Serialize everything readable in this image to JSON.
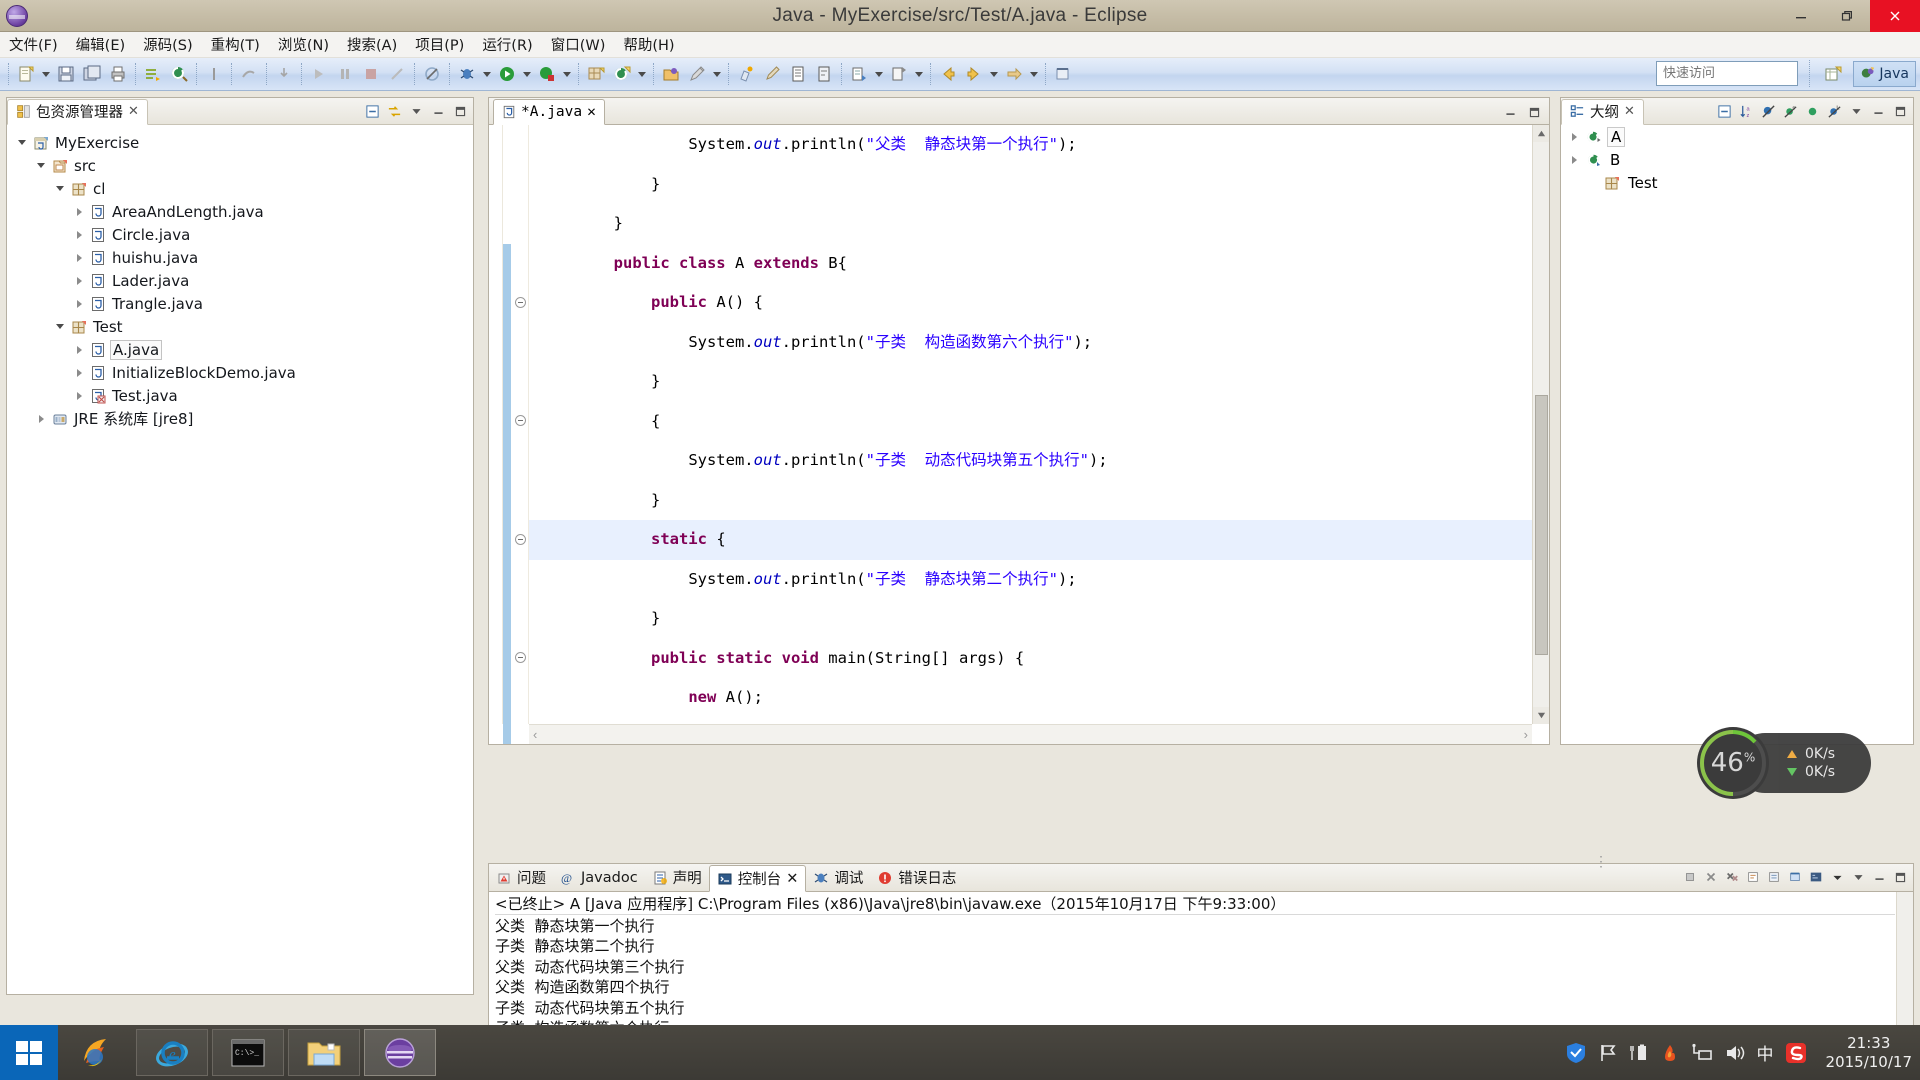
{
  "window": {
    "title": "Java - MyExercise/src/Test/A.java - Eclipse",
    "app_icon": "eclipse-icon",
    "minimize_label": "Minimize",
    "restore_label": "Restore",
    "close_label": "Close"
  },
  "menubar": {
    "items": [
      {
        "label": "文件(F)",
        "name": "menu-file"
      },
      {
        "label": "编辑(E)",
        "name": "menu-edit"
      },
      {
        "label": "源码(S)",
        "name": "menu-source"
      },
      {
        "label": "重构(T)",
        "name": "menu-refactor"
      },
      {
        "label": "浏览(N)",
        "name": "menu-navigate"
      },
      {
        "label": "搜索(A)",
        "name": "menu-search"
      },
      {
        "label": "项目(P)",
        "name": "menu-project"
      },
      {
        "label": "运行(R)",
        "name": "menu-run"
      },
      {
        "label": "窗口(W)",
        "name": "menu-window"
      },
      {
        "label": "帮助(H)",
        "name": "menu-help"
      }
    ]
  },
  "toolbar": {
    "quick_access_placeholder": "快速访问",
    "perspective_label": "Java",
    "open_perspective_tooltip": "打开透视图"
  },
  "package_explorer": {
    "title": "包资源管理器",
    "tree": [
      {
        "label": "MyExercise",
        "indent": 0,
        "twist": "expanded",
        "icon": "java-project-icon",
        "selected": false
      },
      {
        "label": "src",
        "indent": 1,
        "twist": "expanded",
        "icon": "source-folder-icon",
        "selected": false
      },
      {
        "label": "cl",
        "indent": 2,
        "twist": "expanded",
        "icon": "package-icon",
        "selected": false
      },
      {
        "label": "AreaAndLength.java",
        "indent": 3,
        "twist": "collapsed",
        "icon": "java-file-icon",
        "selected": false
      },
      {
        "label": "Circle.java",
        "indent": 3,
        "twist": "collapsed",
        "icon": "java-file-icon",
        "selected": false
      },
      {
        "label": "huishu.java",
        "indent": 3,
        "twist": "collapsed",
        "icon": "java-file-icon",
        "selected": false
      },
      {
        "label": "Lader.java",
        "indent": 3,
        "twist": "collapsed",
        "icon": "java-file-icon",
        "selected": false
      },
      {
        "label": "Trangle.java",
        "indent": 3,
        "twist": "collapsed",
        "icon": "java-file-icon",
        "selected": false
      },
      {
        "label": "Test",
        "indent": 2,
        "twist": "expanded",
        "icon": "package-icon",
        "selected": false
      },
      {
        "label": "A.java",
        "indent": 3,
        "twist": "collapsed",
        "icon": "java-file-icon",
        "selected": true
      },
      {
        "label": "InitializeBlockDemo.java",
        "indent": 3,
        "twist": "collapsed",
        "icon": "java-file-icon",
        "selected": false
      },
      {
        "label": "Test.java",
        "indent": 3,
        "twist": "collapsed",
        "icon": "java-main-file-icon",
        "selected": false
      },
      {
        "label": "JRE 系统库 [jre8]",
        "indent": 1,
        "twist": "collapsed",
        "icon": "jre-library-icon",
        "selected": false
      }
    ]
  },
  "editor": {
    "tab_label": "*A.java",
    "tab_icon": "java-file-icon",
    "lines": [
      {
        "indent": 4,
        "fold": false,
        "changed": false,
        "highlight": false,
        "tokens": [
          {
            "t": "pln",
            "v": "System."
          },
          {
            "t": "fld",
            "v": "out"
          },
          {
            "t": "pln",
            "v": ".println("
          },
          {
            "t": "str",
            "v": "\"父类  静态块第一个执行\""
          },
          {
            "t": "pln",
            "v": ");"
          }
        ]
      },
      {
        "indent": 3,
        "fold": false,
        "changed": false,
        "highlight": false,
        "tokens": [
          {
            "t": "pln",
            "v": "}"
          }
        ]
      },
      {
        "indent": 2,
        "fold": false,
        "changed": false,
        "highlight": false,
        "tokens": [
          {
            "t": "pln",
            "v": "}"
          }
        ]
      },
      {
        "indent": 2,
        "fold": false,
        "changed": true,
        "highlight": false,
        "tokens": [
          {
            "t": "kw",
            "v": "public class"
          },
          {
            "t": "pln",
            "v": " A "
          },
          {
            "t": "kw",
            "v": "extends"
          },
          {
            "t": "pln",
            "v": " B{"
          }
        ]
      },
      {
        "indent": 3,
        "fold": true,
        "changed": true,
        "highlight": false,
        "tokens": [
          {
            "t": "kw",
            "v": "public"
          },
          {
            "t": "pln",
            "v": " A() {"
          }
        ]
      },
      {
        "indent": 4,
        "fold": false,
        "changed": true,
        "highlight": false,
        "tokens": [
          {
            "t": "pln",
            "v": "System."
          },
          {
            "t": "fld",
            "v": "out"
          },
          {
            "t": "pln",
            "v": ".println("
          },
          {
            "t": "str",
            "v": "\"子类  构造函数第六个执行\""
          },
          {
            "t": "pln",
            "v": ");"
          }
        ]
      },
      {
        "indent": 3,
        "fold": false,
        "changed": true,
        "highlight": false,
        "tokens": [
          {
            "t": "pln",
            "v": "}"
          }
        ]
      },
      {
        "indent": 3,
        "fold": true,
        "changed": true,
        "highlight": false,
        "tokens": [
          {
            "t": "pln",
            "v": "{"
          }
        ]
      },
      {
        "indent": 4,
        "fold": false,
        "changed": true,
        "highlight": false,
        "tokens": [
          {
            "t": "pln",
            "v": "System."
          },
          {
            "t": "fld",
            "v": "out"
          },
          {
            "t": "pln",
            "v": ".println("
          },
          {
            "t": "str",
            "v": "\"子类  动态代码块第五个执行\""
          },
          {
            "t": "pln",
            "v": ");"
          }
        ]
      },
      {
        "indent": 3,
        "fold": false,
        "changed": true,
        "highlight": false,
        "tokens": [
          {
            "t": "pln",
            "v": "}"
          }
        ]
      },
      {
        "indent": 3,
        "fold": true,
        "changed": true,
        "highlight": true,
        "tokens": [
          {
            "t": "kw",
            "v": "static"
          },
          {
            "t": "pln",
            "v": " {"
          }
        ]
      },
      {
        "indent": 4,
        "fold": false,
        "changed": true,
        "highlight": false,
        "tokens": [
          {
            "t": "pln",
            "v": "System."
          },
          {
            "t": "fld",
            "v": "out"
          },
          {
            "t": "pln",
            "v": ".println("
          },
          {
            "t": "str",
            "v": "\"子类  静态块第二个执行\""
          },
          {
            "t": "pln",
            "v": ");"
          }
        ]
      },
      {
        "indent": 3,
        "fold": false,
        "changed": true,
        "highlight": false,
        "tokens": [
          {
            "t": "pln",
            "v": "}"
          }
        ]
      },
      {
        "indent": 3,
        "fold": true,
        "changed": true,
        "highlight": false,
        "tokens": [
          {
            "t": "kw",
            "v": "public static void"
          },
          {
            "t": "pln",
            "v": " main(String[] args) {"
          }
        ]
      },
      {
        "indent": 4,
        "fold": false,
        "changed": true,
        "highlight": false,
        "tokens": [
          {
            "t": "kw",
            "v": "new"
          },
          {
            "t": "pln",
            "v": " A();"
          }
        ]
      },
      {
        "indent": 3,
        "fold": false,
        "changed": true,
        "highlight": false,
        "tokens": [
          {
            "t": "pln",
            "v": "}"
          }
        ]
      }
    ]
  },
  "outline": {
    "title": "大纲",
    "items": [
      {
        "label": "Test",
        "indent": 1,
        "twist": "none",
        "icon": "package-icon",
        "selected": false
      },
      {
        "label": "B",
        "indent": 0,
        "twist": "collapsed",
        "icon": "class-icon",
        "selected": false
      },
      {
        "label": "A",
        "indent": 0,
        "twist": "collapsed",
        "icon": "class-default-icon",
        "selected": true
      }
    ],
    "tools": [
      {
        "name": "collapse-all-icon"
      },
      {
        "name": "sort-alphabetical-icon"
      },
      {
        "name": "hide-fields-icon"
      },
      {
        "name": "hide-static-icon"
      },
      {
        "name": "hide-public-icon"
      },
      {
        "name": "hide-local-types-icon"
      },
      {
        "name": "view-menu-icon"
      },
      {
        "name": "minimize-icon"
      },
      {
        "name": "maximize-icon"
      }
    ]
  },
  "console": {
    "tabs": [
      {
        "label": "问题",
        "icon": "problems-icon",
        "active": false,
        "closable": false
      },
      {
        "label": "Javadoc",
        "icon": "javadoc-icon",
        "active": false,
        "closable": false
      },
      {
        "label": "声明",
        "icon": "declaration-icon",
        "active": false,
        "closable": false
      },
      {
        "label": "控制台",
        "icon": "console-icon",
        "active": true,
        "closable": true
      },
      {
        "label": "调试",
        "icon": "debug-icon",
        "active": false,
        "closable": false
      },
      {
        "label": "错误日志",
        "icon": "error-log-icon",
        "active": false,
        "closable": false
      }
    ],
    "header": "<已终止> A [Java 应用程序] C:\\Program Files (x86)\\Java\\jre8\\bin\\javaw.exe（2015年10月17日 下午9:33:00）",
    "output": [
      "父类  静态块第一个执行",
      "子类  静态块第二个执行",
      "父类  动态代码块第三个执行",
      "父类  构造函数第四个执行",
      "子类  动态代码块第五个执行",
      "子类  构造函数第六个执行"
    ]
  },
  "netspeed": {
    "percent": "46",
    "percent_unit": "%",
    "upload": "0K/s",
    "download": "0K/s"
  },
  "taskbar": {
    "start_label": "开始",
    "items": [
      {
        "name": "taskbar-firefox-icon",
        "pinned": false,
        "active": false
      },
      {
        "name": "taskbar-ie-icon",
        "pinned": true,
        "active": false
      },
      {
        "name": "taskbar-cmd-icon",
        "pinned": true,
        "active": false
      },
      {
        "name": "taskbar-explorer-icon",
        "pinned": true,
        "active": false
      },
      {
        "name": "taskbar-eclipse-icon",
        "pinned": true,
        "active": true
      }
    ],
    "tray": [
      {
        "name": "tray-security-shield-icon"
      },
      {
        "name": "tray-flag-icon"
      },
      {
        "name": "tray-battery-icon"
      },
      {
        "name": "tray-fire-icon"
      },
      {
        "name": "tray-network-icon"
      },
      {
        "name": "tray-volume-icon"
      },
      {
        "name": "tray-ime-chinese-icon",
        "label": "中"
      },
      {
        "name": "tray-sogou-icon"
      }
    ],
    "clock_time": "21:33",
    "clock_date": "2015/10/17"
  },
  "colors": {
    "titlebar": "#c6bda7",
    "toolbar": "#cddff3",
    "accent_close": "#e81123",
    "keyword": "#7f0055",
    "string": "#2a00ff",
    "field": "#0000c0",
    "highlight_line": "#e8f0fe",
    "change_bar": "#a6cbe8",
    "taskbar": "#3c3a35",
    "start_button": "#0a66b8"
  }
}
